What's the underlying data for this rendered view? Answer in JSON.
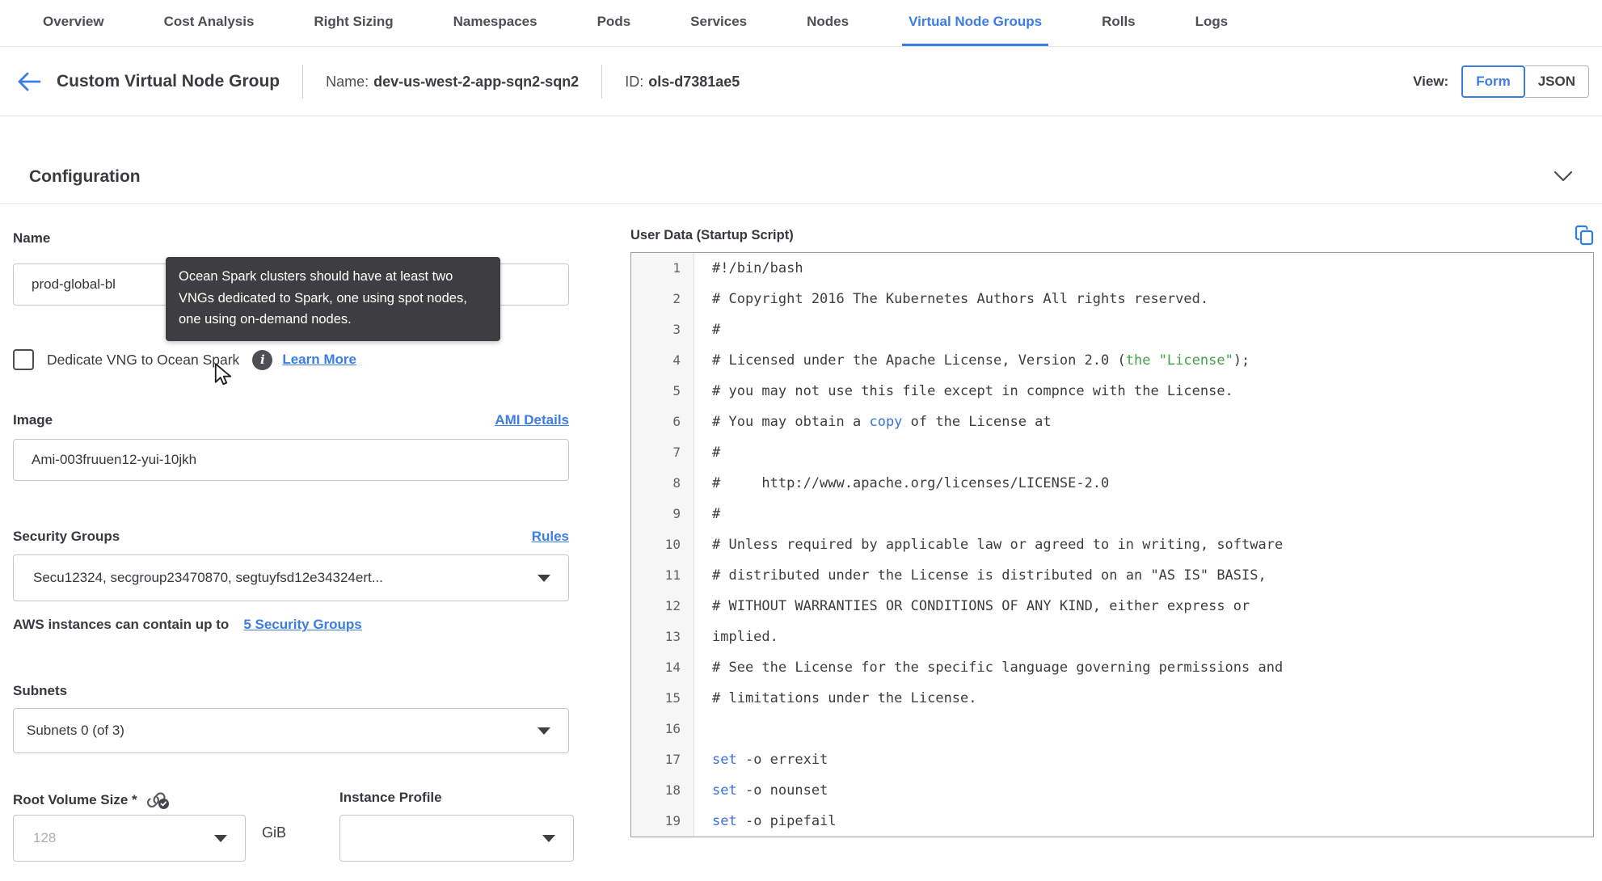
{
  "tabs": {
    "items": [
      {
        "label": "Overview"
      },
      {
        "label": "Cost Analysis"
      },
      {
        "label": "Right Sizing"
      },
      {
        "label": "Namespaces"
      },
      {
        "label": "Pods"
      },
      {
        "label": "Services"
      },
      {
        "label": "Nodes"
      },
      {
        "label": "Virtual Node Groups",
        "active": true
      },
      {
        "label": "Rolls"
      },
      {
        "label": "Logs"
      }
    ]
  },
  "header": {
    "title": "Custom Virtual Node Group",
    "name_label": "Name:",
    "name_value": "dev-us-west-2-app-sqn2-sqn2",
    "id_label": "ID:",
    "id_value": "ols-d7381ae5",
    "view_label": "View:",
    "view_form": "Form",
    "view_json": "JSON"
  },
  "section": {
    "title": "Configuration"
  },
  "form": {
    "name": {
      "label": "Name",
      "value": "prod-global-bl"
    },
    "tooltip": "Ocean Spark clusters should have at least two VNGs dedicated to Spark, one using spot nodes, one using on-demand nodes.",
    "dedicate": {
      "label": "Dedicate VNG to Ocean Spark",
      "link": "Learn More",
      "checked": false
    },
    "image": {
      "label": "Image",
      "link": "AMI Details",
      "value": "Ami-003fruuen12-yui-10jkh"
    },
    "security_groups": {
      "label": "Security Groups",
      "link": "Rules",
      "value": "Secu12324, secgroup23470870, segtuyfsd12e34324ert...",
      "helper_text": "AWS instances can contain up to",
      "helper_link": "5 Security Groups"
    },
    "subnets": {
      "label": "Subnets",
      "value": "Subnets 0 (of 3)"
    },
    "root_volume": {
      "label": "Root Volume Size *",
      "placeholder": "128",
      "unit": "GiB"
    },
    "instance_profile": {
      "label": "Instance Profile",
      "value": ""
    }
  },
  "editor": {
    "title": "User Data (Startup Script)",
    "lines": [
      [
        {
          "t": "#!/bin/bash",
          "c": "d"
        }
      ],
      [
        {
          "t": "# Copyright 2016 The Kubernetes Authors All rights reserved.",
          "c": "d"
        }
      ],
      [
        {
          "t": "#",
          "c": "d"
        }
      ],
      [
        {
          "t": "# Licensed under the Apache License, Version 2.0 (",
          "c": "d"
        },
        {
          "t": "the \"License\"",
          "c": "g"
        },
        {
          "t": ");",
          "c": "d"
        }
      ],
      [
        {
          "t": "# you may not use this file except in compnce with the License.",
          "c": "d"
        }
      ],
      [
        {
          "t": "# You may obtain a ",
          "c": "d"
        },
        {
          "t": "copy",
          "c": "b"
        },
        {
          "t": " of the License at",
          "c": "d"
        }
      ],
      [
        {
          "t": "#",
          "c": "d"
        }
      ],
      [
        {
          "t": "#     http://www.apache.org/licenses/LICENSE-2.0",
          "c": "d"
        }
      ],
      [
        {
          "t": "#",
          "c": "d"
        }
      ],
      [
        {
          "t": "# Unless required by applicable law or agreed to in writing, software",
          "c": "d"
        }
      ],
      [
        {
          "t": "# distributed under the License is distributed on an \"AS IS\" BASIS,",
          "c": "d"
        }
      ],
      [
        {
          "t": "# WITHOUT WARRANTIES OR CONDITIONS OF ANY KIND, either express or",
          "c": "d"
        }
      ],
      [
        {
          "t": "implied.",
          "c": "d"
        }
      ],
      [
        {
          "t": "# See the License for the specific language governing permissions and",
          "c": "d"
        }
      ],
      [
        {
          "t": "# limitations under the License.",
          "c": "d"
        }
      ],
      [],
      [
        {
          "t": "set",
          "c": "b"
        },
        {
          "t": " -o errexit",
          "c": "d"
        }
      ],
      [
        {
          "t": "set",
          "c": "b"
        },
        {
          "t": " -o nounset",
          "c": "d"
        }
      ],
      [
        {
          "t": "set",
          "c": "b"
        },
        {
          "t": " -o pipefail",
          "c": "d"
        }
      ]
    ]
  },
  "colors": {
    "accent": "#3b7de2",
    "code_default": "#3d3d3d",
    "code_green": "#43a047",
    "code_blue": "#3a6fdf"
  }
}
